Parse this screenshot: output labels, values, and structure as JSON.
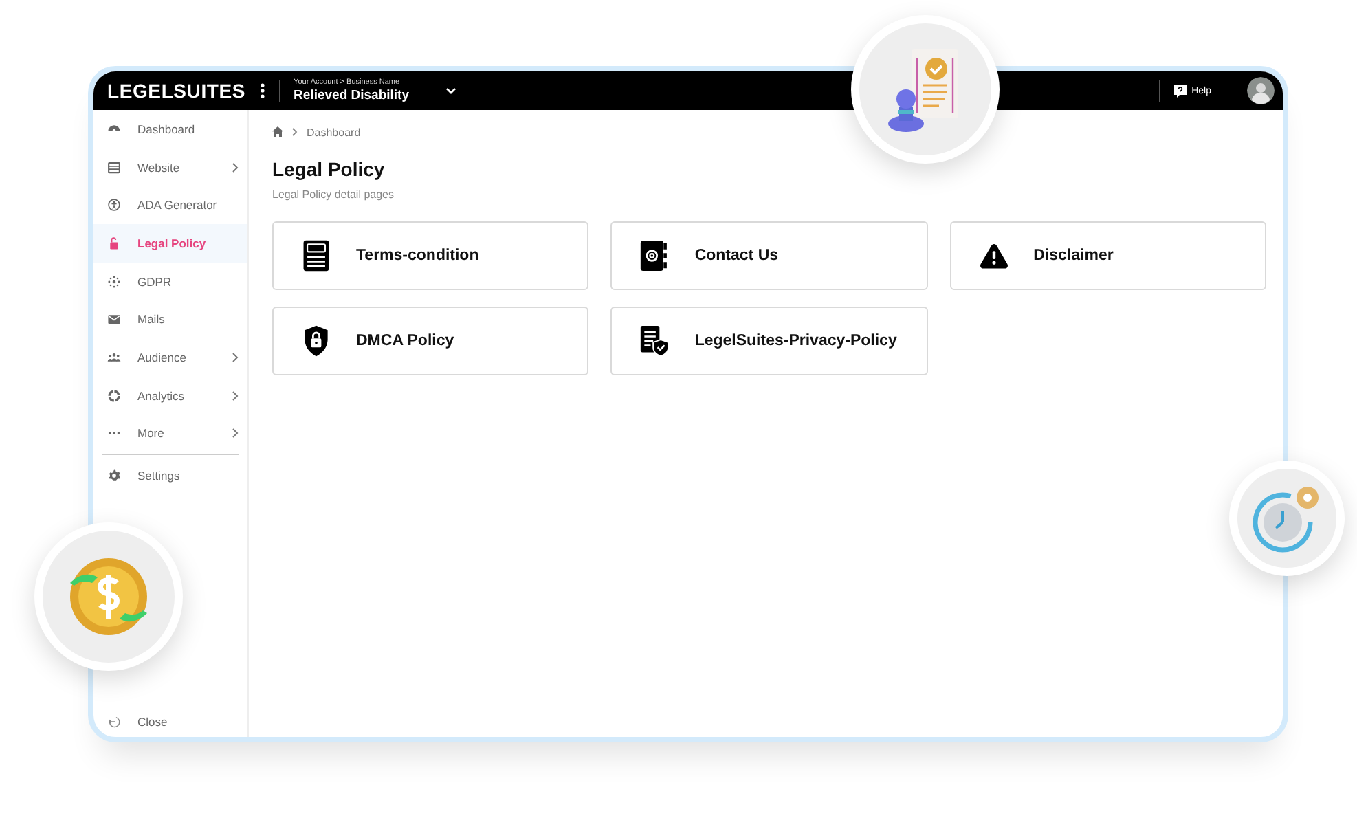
{
  "topbar": {
    "logo": "LEGELSUITES",
    "account_path": "Your Account > Business Name",
    "business_name": "Relieved Disability",
    "help_label": "Help"
  },
  "sidebar": {
    "items": [
      {
        "label": "Dashboard",
        "selected": false,
        "submenu": false
      },
      {
        "label": "Website",
        "selected": false,
        "submenu": true
      },
      {
        "label": "ADA Generator",
        "selected": false,
        "submenu": false
      },
      {
        "label": "Legal Policy",
        "selected": true,
        "submenu": false
      },
      {
        "label": "GDPR",
        "selected": false,
        "submenu": false
      },
      {
        "label": "Mails",
        "selected": false,
        "submenu": false
      },
      {
        "label": "Audience",
        "selected": false,
        "submenu": true
      },
      {
        "label": "Analytics",
        "selected": false,
        "submenu": true
      },
      {
        "label": "More",
        "selected": false,
        "submenu": true
      }
    ],
    "settings": "Settings",
    "close": "Close"
  },
  "breadcrumb": "Dashboard",
  "title": "Legal Policy",
  "subtitle": "Legal Policy detail pages",
  "cards": [
    {
      "label": "Terms-condition"
    },
    {
      "label": "Contact Us"
    },
    {
      "label": "Disclaimer"
    },
    {
      "label": "DMCA Policy"
    },
    {
      "label": "LegelSuites-Privacy-Policy"
    }
  ]
}
